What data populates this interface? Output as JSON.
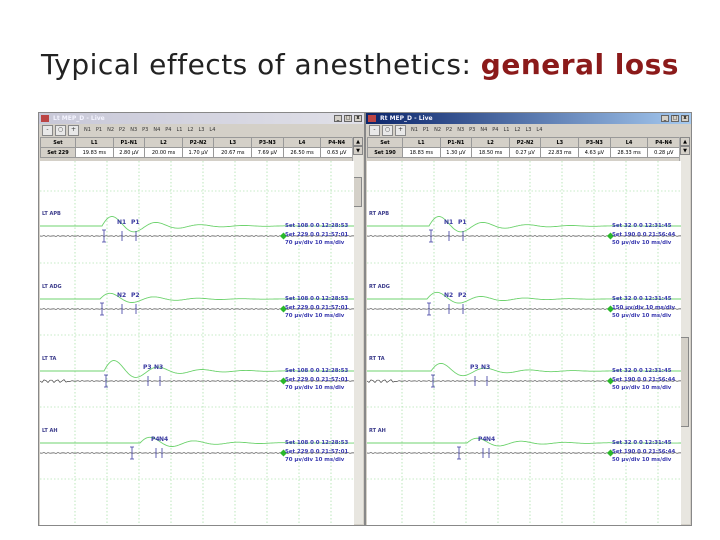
{
  "slide": {
    "title_plain": "Typical effects of anesthetics:",
    "title_accent": "general loss"
  },
  "colors": {
    "accent": "#8b1a1a",
    "trace_green": "#6fd36f",
    "trace_gray": "#444444",
    "annotation": "#3a3ab0"
  },
  "toolbar_markers": [
    "N1",
    "P1",
    "N2",
    "P2",
    "N3",
    "P3",
    "N4",
    "P4",
    "L1",
    "L2",
    "L3",
    "L4"
  ],
  "table_headers": [
    "Set",
    "L1",
    "P1-N1",
    "L2",
    "P2-N2",
    "L3",
    "P3-N3",
    "L4",
    "P4-N4"
  ],
  "windows": [
    {
      "title": "Lt MEP_D - Live",
      "row": [
        "Set 229",
        "19.83 ms",
        "2.80 µV",
        "20.00 ms",
        "1.70 µV",
        "20.67 ms",
        "7.69 µV",
        "26.50 ms",
        "0.63 µV"
      ],
      "channels": [
        {
          "label": "LT APB",
          "markers": [
            "N1",
            "P1"
          ],
          "ann": [
            "Set 108 0 0 12:28:53",
            "Set 229 0 0 21:57:01",
            "70 µv/div 10 ms/div"
          ]
        },
        {
          "label": "LT ADG",
          "markers": [
            "N2",
            "P2"
          ],
          "ann": [
            "Set 108 0 0 12:28:53",
            "Set 229 0 0 21:57:01",
            "70 µv/div 10 ms/div"
          ]
        },
        {
          "label": "LT TA",
          "markers": [
            "P3",
            "N3"
          ],
          "ann": [
            "Set 108 0 0 12:28:53",
            "Set 229 0 0 21:57:01",
            "70 µv/div 10 ms/div"
          ]
        },
        {
          "label": "LT AH",
          "markers": [
            "P4",
            "N4"
          ],
          "ann": [
            "Set 108 0 0 12:28:53",
            "Set 229 0 0 21:57:01",
            "70 µv/div 10 ms/div"
          ]
        }
      ]
    },
    {
      "title": "Rt MEP_D - Live",
      "row": [
        "Set 190",
        "18.83 ms",
        "1.30 µV",
        "18.50 ms",
        "0.27 µV",
        "22.83 ms",
        "4.63 µV",
        "28.33 ms",
        "0.28 µV"
      ],
      "channels": [
        {
          "label": "RT APB",
          "markers": [
            "N1",
            "P1"
          ],
          "ann": [
            "Set 32 0 0 12:31:45",
            "Set 190 0 0 21:56:44",
            "50 µv/div 10 ms/div"
          ]
        },
        {
          "label": "RT ADG",
          "markers": [
            "N2",
            "P2"
          ],
          "ann": [
            "Set 32 0 0 12:31:45",
            "150 µv/div 10 ms/div",
            "50 µv/div 10 ms/div"
          ]
        },
        {
          "label": "RT TA",
          "markers": [
            "P3",
            "N3"
          ],
          "ann": [
            "Set 32 0 0 12:31:45",
            "Set 190 0 0 21:56:44",
            "50 µv/div 10 ms/div"
          ]
        },
        {
          "label": "RT AH",
          "markers": [
            "P4",
            "N4"
          ],
          "ann": [
            "Set 32 0 0 12:31:45",
            "Set 190 0 0 21:56:44",
            "50 µv/div 10 ms/div"
          ]
        }
      ]
    }
  ]
}
